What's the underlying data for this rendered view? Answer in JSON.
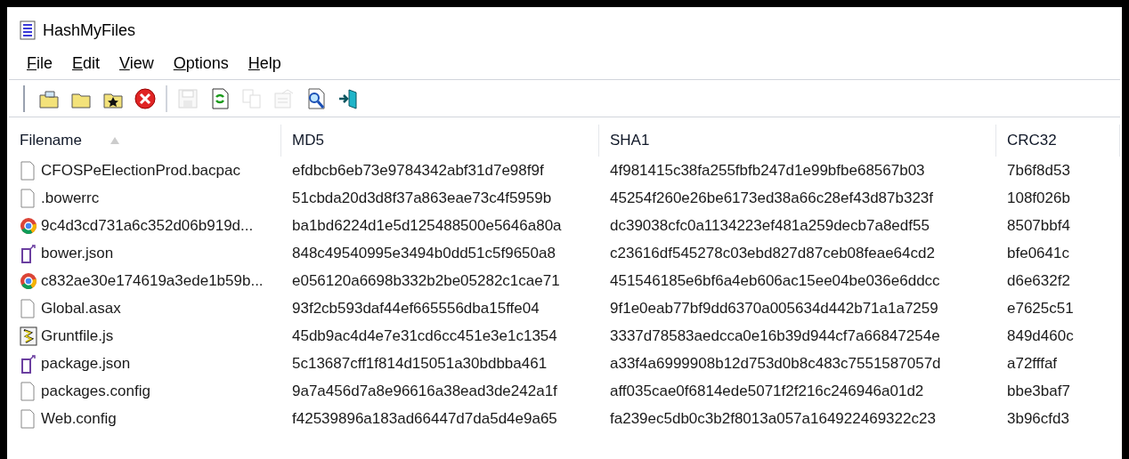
{
  "window": {
    "title": "HashMyFiles"
  },
  "menu": [
    {
      "label": "File"
    },
    {
      "label": "Edit"
    },
    {
      "label": "View"
    },
    {
      "label": "Options"
    },
    {
      "label": "Help"
    }
  ],
  "toolbar": [
    {
      "kind": "open-files",
      "disabled": false
    },
    {
      "kind": "open-folder",
      "disabled": false
    },
    {
      "kind": "star-folder",
      "disabled": false
    },
    {
      "kind": "remove",
      "disabled": false
    },
    {
      "kind": "separator"
    },
    {
      "kind": "save",
      "disabled": true
    },
    {
      "kind": "refresh",
      "disabled": false
    },
    {
      "kind": "copy",
      "disabled": true
    },
    {
      "kind": "properties",
      "disabled": true
    },
    {
      "kind": "find",
      "disabled": false
    },
    {
      "kind": "exit",
      "disabled": false
    }
  ],
  "table": {
    "columns": [
      {
        "label": "Filename",
        "sorted": true
      },
      {
        "label": "MD5",
        "sorted": false
      },
      {
        "label": "SHA1",
        "sorted": false
      },
      {
        "label": "CRC32",
        "sorted": false
      }
    ],
    "rows": [
      {
        "kind": "document",
        "filename": "CFOSPeElectionProd.bacpac",
        "md5": "efdbcb6eb73e9784342abf31d7e98f9f",
        "sha1": "4f981415c38fa255fbfb247d1e99bfbe68567b03",
        "crc32": "7b6f8d53"
      },
      {
        "kind": "document",
        "filename": ".bowerrc",
        "md5": "51cbda20d3d8f37a863eae73c4f5959b",
        "sha1": "45254f260e26be6173ed38a66c28ef43d87b323f",
        "crc32": "108f026b"
      },
      {
        "kind": "browser",
        "filename": "9c4d3cd731a6c352d06b919d...",
        "md5": "ba1bd6224d1e5d125488500e5646a80a",
        "sha1": "dc39038cfc0a1134223ef481a259decb7a8edf55",
        "crc32": "8507bbf4"
      },
      {
        "kind": "json",
        "filename": "bower.json",
        "md5": "848c49540995e3494b0dd51c5f9650a8",
        "sha1": "c23616df545278c03ebd827d87ceb08feae64cd2",
        "crc32": "bfe0641c"
      },
      {
        "kind": "browser",
        "filename": "c832ae30e174619a3ede1b59b...",
        "md5": "e056120a6698b332b2be05282c1cae71",
        "sha1": "451546185e6bf6a4eb606ac15ee04be036e6ddcc",
        "crc32": "d6e632f2"
      },
      {
        "kind": "document",
        "filename": "Global.asax",
        "md5": "93f2cb593daf44ef665556dba15ffe04",
        "sha1": "9f1e0eab77bf9dd6370a005634d442b71a1a7259",
        "crc32": "e7625c51"
      },
      {
        "kind": "script",
        "filename": "Gruntfile.js",
        "md5": "45db9ac4d4e7e31cd6cc451e3e1c1354",
        "sha1": "3337d78583aedcca0e16b39d944cf7a66847254e",
        "crc32": "849d460c"
      },
      {
        "kind": "json",
        "filename": "package.json",
        "md5": "5c13687cff1f814d15051a30bdbba461",
        "sha1": "a33f4a6999908b12d753d0b8c483c7551587057d",
        "crc32": "a72fffaf"
      },
      {
        "kind": "document",
        "filename": "packages.config",
        "md5": "9a7a456d7a8e96616a38ead3de242a1f",
        "sha1": "aff035cae0f6814ede5071f2f216c246946a01d2",
        "crc32": "bbe3baf7"
      },
      {
        "kind": "document",
        "filename": "Web.config",
        "md5": "f42539896a183ad66447d7da5d4e9a65",
        "sha1": "fa239ec5db0c3b2f8013a057a164922469322c23",
        "crc32": "3b96cfd3"
      }
    ]
  }
}
